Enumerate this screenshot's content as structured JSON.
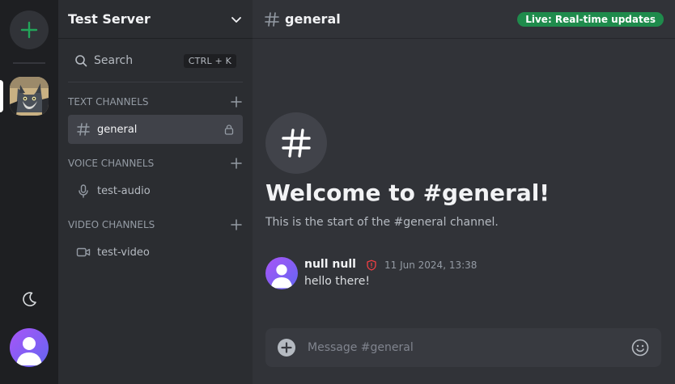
{
  "server": {
    "name": "Test Server"
  },
  "search": {
    "label": "Search",
    "shortcut": "CTRL + K"
  },
  "categories": [
    {
      "label": "TEXT CHANNELS",
      "channels": [
        {
          "label": "general",
          "icon": "hash-icon",
          "locked": true,
          "active": true
        }
      ]
    },
    {
      "label": "VOICE CHANNELS",
      "channels": [
        {
          "label": "test-audio",
          "icon": "microphone-icon"
        }
      ]
    },
    {
      "label": "VIDEO CHANNELS",
      "channels": [
        {
          "label": "test-video",
          "icon": "video-camera-icon"
        }
      ]
    }
  ],
  "main": {
    "channel_title": "general",
    "live_badge": "Live: Real-time updates",
    "welcome_title": "Welcome to #general!",
    "welcome_subtitle": "This is the start of the #general channel."
  },
  "message": {
    "author": "null null",
    "timestamp": "11 Jun 2024, 13:38",
    "text": "hello there!"
  },
  "composer": {
    "placeholder": "Message #general"
  },
  "colors": {
    "brand_green": "#23a55a",
    "live_badge": "#1f8b4c",
    "avatar_gradient_start": "#a855f7",
    "avatar_gradient_end": "#6366f1",
    "shield_red": "#f23f43"
  }
}
